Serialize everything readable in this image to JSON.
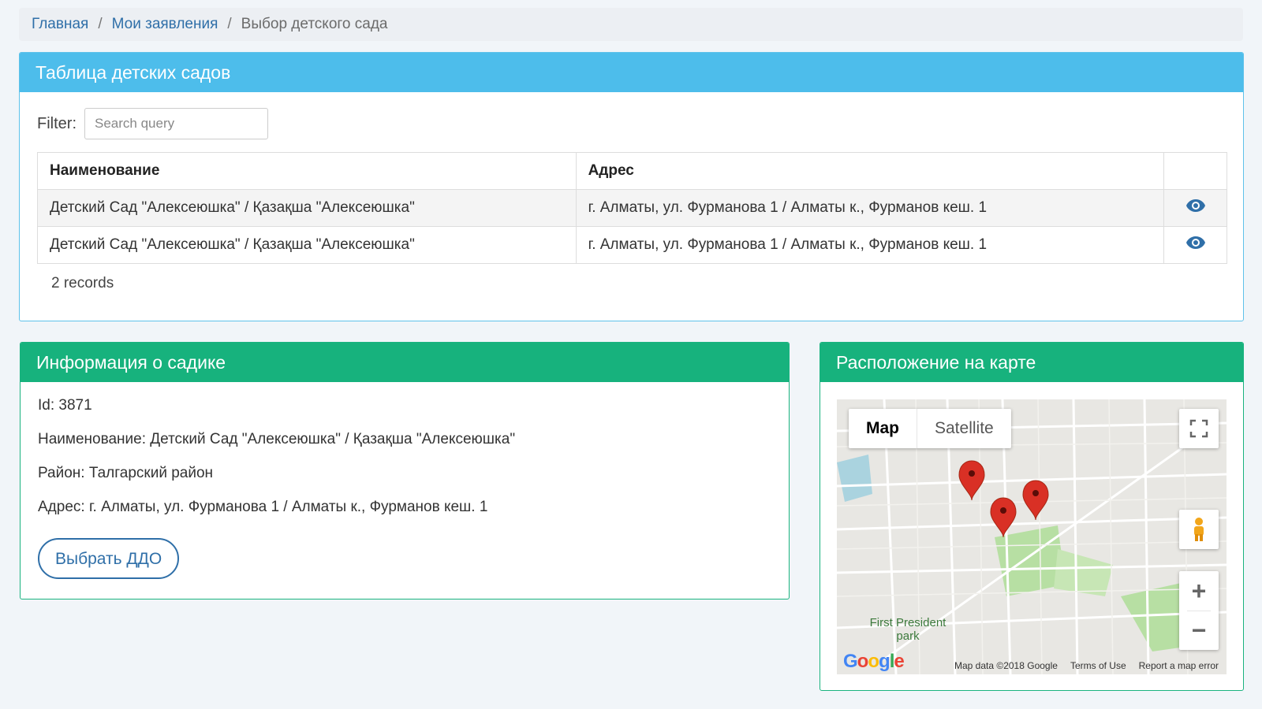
{
  "breadcrumb": {
    "home": "Главная",
    "applications": "Мои заявления",
    "current": "Выбор детского сада",
    "separator": "/"
  },
  "table_panel": {
    "title": "Таблица детских садов",
    "filter_label": "Filter:",
    "filter_placeholder": "Search query",
    "columns": [
      "Наименование",
      "Адрес",
      ""
    ],
    "rows": [
      {
        "name": "Детский Сад \"Алексеюшка\" / Қазақша \"Алексеюшка\"",
        "address": "г. Алматы, ул. Фурманова 1 / Алматы к., Фурманов кеш. 1",
        "action_icon": "eye-icon"
      },
      {
        "name": "Детский Сад \"Алексеюшка\" / Қазақша \"Алексеюшка\"",
        "address": "г. Алматы, ул. Фурманова 1 / Алматы к., Фурманов кеш. 1",
        "action_icon": "eye-icon"
      }
    ],
    "records": "2 records"
  },
  "info_panel": {
    "title": "Информация о садике",
    "id_line": "Id: 3871",
    "name_line": "Наименование: Детский Сад \"Алексеюшка\" / Қазақша \"Алексеюшка\"",
    "district_line": "Район: Талгарский район",
    "address_line": "Адрес: г. Алматы, ул. Фурманова 1 / Алматы к., Фурманов кеш. 1",
    "select_button": "Выбрать ДДО"
  },
  "map_panel": {
    "title": "Расположение на карте",
    "map_type_map": "Map",
    "map_type_satellite": "Satellite",
    "park_label": "First President park",
    "google": "Google",
    "map_data": "Map data ©2018 Google",
    "terms": "Terms of Use",
    "report": "Report a map error",
    "zoom_in": "+",
    "zoom_out": "−"
  },
  "colors": {
    "accent_blue": "#4dbdeb",
    "accent_green": "#17b27d",
    "link": "#2f6fa8",
    "marker": "#d93025"
  }
}
